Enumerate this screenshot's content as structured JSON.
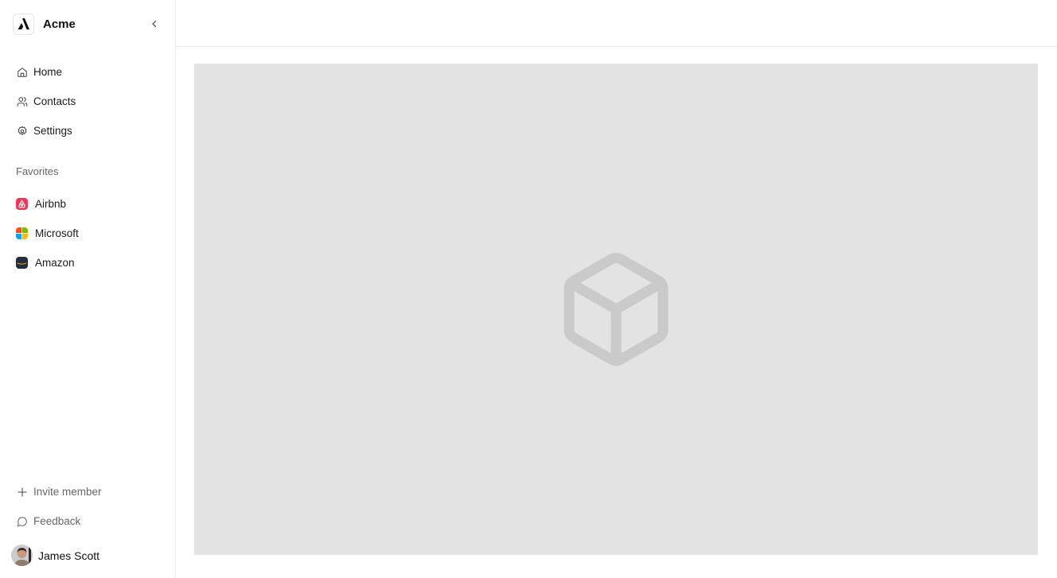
{
  "app": {
    "name": "Acme"
  },
  "sidebar": {
    "nav": [
      {
        "label": "Home",
        "icon": "home-icon"
      },
      {
        "label": "Contacts",
        "icon": "users-icon"
      },
      {
        "label": "Settings",
        "icon": "gear-icon"
      }
    ],
    "favorites_label": "Favorites",
    "favorites": [
      {
        "label": "Airbnb",
        "icon": "airbnb-icon",
        "color": "#e8395c"
      },
      {
        "label": "Microsoft",
        "icon": "microsoft-icon",
        "colors": [
          "#f25022",
          "#7fba00",
          "#00a4ef",
          "#ffb900"
        ]
      },
      {
        "label": "Amazon",
        "icon": "amazon-icon",
        "color": "#232f3e"
      }
    ],
    "bottom": [
      {
        "label": "Invite member",
        "icon": "plus-icon"
      },
      {
        "label": "Feedback",
        "icon": "message-circle-icon"
      }
    ],
    "user": {
      "name": "James Scott"
    }
  },
  "main": {
    "placeholder_icon": "box-icon",
    "placeholder_color": "#e3e3e3"
  }
}
